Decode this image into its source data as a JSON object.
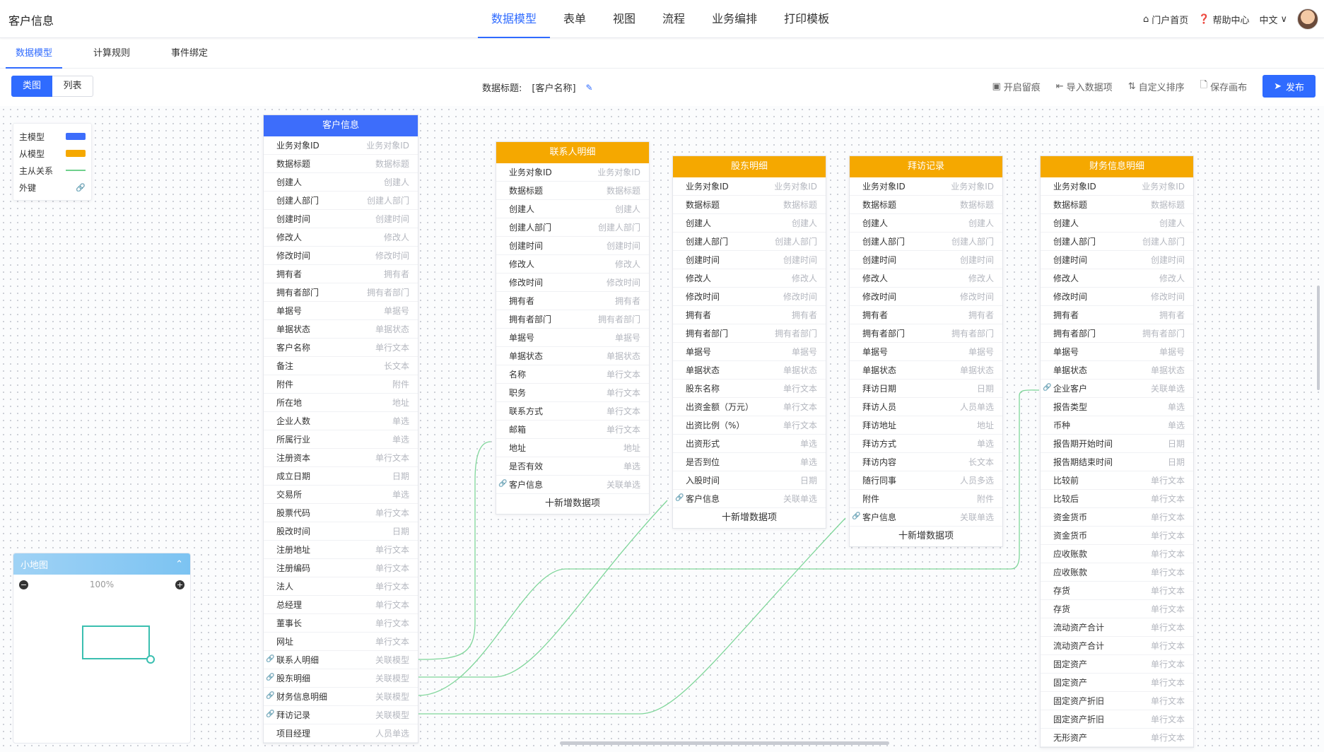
{
  "header": {
    "title": "客户信息",
    "nav": [
      "数据模型",
      "表单",
      "视图",
      "流程",
      "业务编排",
      "打印模板"
    ],
    "home": "门户首页",
    "help": "帮助中心",
    "lang": "中文"
  },
  "subtabs": [
    "数据模型",
    "计算规则",
    "事件绑定"
  ],
  "toolbar": {
    "view_chart": "类图",
    "view_list": "列表",
    "data_title_label": "数据标题:",
    "data_title_value": "[客户名称]",
    "actions": [
      "开启留痕",
      "导入数据项",
      "自定义排序",
      "保存画布"
    ],
    "publish": "发布"
  },
  "legend": {
    "items": [
      "主模型",
      "从模型",
      "主从关系",
      "外键"
    ],
    "main_color": "#3d6dfb",
    "sub_color": "#f5a800",
    "relation_color": "#6fd08c"
  },
  "minimap": {
    "title": "小地图",
    "zoom": "100%"
  },
  "add_item_label": "十新增数据项",
  "entities": [
    {
      "title": "客户信息",
      "kind": "main",
      "fields": [
        [
          "业务对象ID",
          "业务对象ID"
        ],
        [
          "数据标题",
          "数据标题"
        ],
        [
          "创建人",
          "创建人"
        ],
        [
          "创建人部门",
          "创建人部门"
        ],
        [
          "创建时间",
          "创建时间"
        ],
        [
          "修改人",
          "修改人"
        ],
        [
          "修改时间",
          "修改时间"
        ],
        [
          "拥有者",
          "拥有者"
        ],
        [
          "拥有者部门",
          "拥有者部门"
        ],
        [
          "单据号",
          "单据号"
        ],
        [
          "单据状态",
          "单据状态"
        ],
        [
          "客户名称",
          "单行文本"
        ],
        [
          "备注",
          "长文本"
        ],
        [
          "附件",
          "附件"
        ],
        [
          "所在地",
          "地址"
        ],
        [
          "企业人数",
          "单选"
        ],
        [
          "所属行业",
          "单选"
        ],
        [
          "注册资本",
          "单行文本"
        ],
        [
          "成立日期",
          "日期"
        ],
        [
          "交易所",
          "单选"
        ],
        [
          "股票代码",
          "单行文本"
        ],
        [
          "股改时间",
          "日期"
        ],
        [
          "注册地址",
          "单行文本"
        ],
        [
          "注册编码",
          "单行文本"
        ],
        [
          "法人",
          "单行文本"
        ],
        [
          "总经理",
          "单行文本"
        ],
        [
          "董事长",
          "单行文本"
        ],
        [
          "网址",
          "单行文本"
        ],
        [
          "联系人明细",
          "关联模型"
        ],
        [
          "股东明细",
          "关联模型"
        ],
        [
          "财务信息明细",
          "关联模型"
        ],
        [
          "拜访记录",
          "关联模型"
        ],
        [
          "项目经理",
          "人员单选"
        ]
      ]
    },
    {
      "title": "联系人明细",
      "kind": "sub",
      "fields": [
        [
          "业务对象ID",
          "业务对象ID"
        ],
        [
          "数据标题",
          "数据标题"
        ],
        [
          "创建人",
          "创建人"
        ],
        [
          "创建人部门",
          "创建人部门"
        ],
        [
          "创建时间",
          "创建时间"
        ],
        [
          "修改人",
          "修改人"
        ],
        [
          "修改时间",
          "修改时间"
        ],
        [
          "拥有者",
          "拥有者"
        ],
        [
          "拥有者部门",
          "拥有者部门"
        ],
        [
          "单据号",
          "单据号"
        ],
        [
          "单据状态",
          "单据状态"
        ],
        [
          "名称",
          "单行文本"
        ],
        [
          "职务",
          "单行文本"
        ],
        [
          "联系方式",
          "单行文本"
        ],
        [
          "邮箱",
          "单行文本"
        ],
        [
          "地址",
          "地址"
        ],
        [
          "是否有效",
          "单选"
        ],
        [
          "客户信息",
          "关联单选"
        ]
      ]
    },
    {
      "title": "股东明细",
      "kind": "sub",
      "fields": [
        [
          "业务对象ID",
          "业务对象ID"
        ],
        [
          "数据标题",
          "数据标题"
        ],
        [
          "创建人",
          "创建人"
        ],
        [
          "创建人部门",
          "创建人部门"
        ],
        [
          "创建时间",
          "创建时间"
        ],
        [
          "修改人",
          "修改人"
        ],
        [
          "修改时间",
          "修改时间"
        ],
        [
          "拥有者",
          "拥有者"
        ],
        [
          "拥有者部门",
          "拥有者部门"
        ],
        [
          "单据号",
          "单据号"
        ],
        [
          "单据状态",
          "单据状态"
        ],
        [
          "股东名称",
          "单行文本"
        ],
        [
          "出资金额（万元）",
          "单行文本"
        ],
        [
          "出资比例（%）",
          "单行文本"
        ],
        [
          "出资形式",
          "单选"
        ],
        [
          "是否到位",
          "单选"
        ],
        [
          "入股时间",
          "日期"
        ],
        [
          "客户信息",
          "关联单选"
        ]
      ]
    },
    {
      "title": "拜访记录",
      "kind": "sub",
      "fields": [
        [
          "业务对象ID",
          "业务对象ID"
        ],
        [
          "数据标题",
          "数据标题"
        ],
        [
          "创建人",
          "创建人"
        ],
        [
          "创建人部门",
          "创建人部门"
        ],
        [
          "创建时间",
          "创建时间"
        ],
        [
          "修改人",
          "修改人"
        ],
        [
          "修改时间",
          "修改时间"
        ],
        [
          "拥有者",
          "拥有者"
        ],
        [
          "拥有者部门",
          "拥有者部门"
        ],
        [
          "单据号",
          "单据号"
        ],
        [
          "单据状态",
          "单据状态"
        ],
        [
          "拜访日期",
          "日期"
        ],
        [
          "拜访人员",
          "人员单选"
        ],
        [
          "拜访地址",
          "地址"
        ],
        [
          "拜访方式",
          "单选"
        ],
        [
          "拜访内容",
          "长文本"
        ],
        [
          "随行同事",
          "人员多选"
        ],
        [
          "附件",
          "附件"
        ],
        [
          "客户信息",
          "关联单选"
        ]
      ]
    },
    {
      "title": "财务信息明细",
      "kind": "sub",
      "fields": [
        [
          "业务对象ID",
          "业务对象ID"
        ],
        [
          "数据标题",
          "数据标题"
        ],
        [
          "创建人",
          "创建人"
        ],
        [
          "创建人部门",
          "创建人部门"
        ],
        [
          "创建时间",
          "创建时间"
        ],
        [
          "修改人",
          "修改人"
        ],
        [
          "修改时间",
          "修改时间"
        ],
        [
          "拥有者",
          "拥有者"
        ],
        [
          "拥有者部门",
          "拥有者部门"
        ],
        [
          "单据号",
          "单据号"
        ],
        [
          "单据状态",
          "单据状态"
        ],
        [
          "企业客户",
          "关联单选"
        ],
        [
          "报告类型",
          "单选"
        ],
        [
          "币种",
          "单选"
        ],
        [
          "报告期开始时间",
          "日期"
        ],
        [
          "报告期结束时间",
          "日期"
        ],
        [
          "比较前",
          "单行文本"
        ],
        [
          "比较后",
          "单行文本"
        ],
        [
          "资金货币",
          "单行文本"
        ],
        [
          "资金货币",
          "单行文本"
        ],
        [
          "应收账款",
          "单行文本"
        ],
        [
          "应收账款",
          "单行文本"
        ],
        [
          "存货",
          "单行文本"
        ],
        [
          "存货",
          "单行文本"
        ],
        [
          "流动资产合计",
          "单行文本"
        ],
        [
          "流动资产合计",
          "单行文本"
        ],
        [
          "固定资产",
          "单行文本"
        ],
        [
          "固定资产",
          "单行文本"
        ],
        [
          "固定资产折旧",
          "单行文本"
        ],
        [
          "固定资产折旧",
          "单行文本"
        ],
        [
          "无形资产",
          "单行文本"
        ]
      ]
    }
  ]
}
